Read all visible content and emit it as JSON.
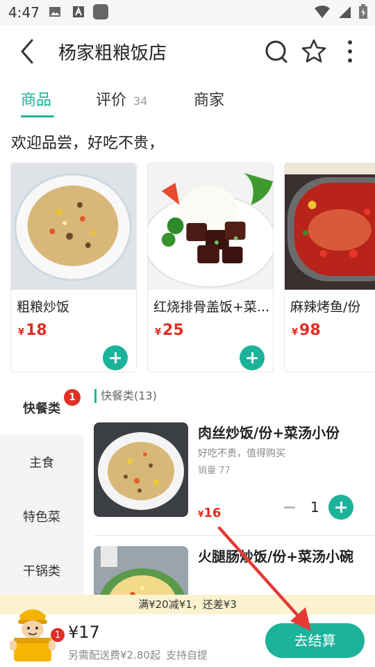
{
  "status_bar": {
    "time": "4:47"
  },
  "header": {
    "title": "杨家粗粮饭店"
  },
  "tabs": [
    {
      "label": "商品"
    },
    {
      "label": "评价",
      "count": "34"
    },
    {
      "label": "商家"
    }
  ],
  "welcome": "欢迎品尝，好吃不贵，",
  "featured": [
    {
      "name": "粗粮炒饭",
      "currency": "¥",
      "price": "18"
    },
    {
      "name": "红烧排骨盖饭+菜...",
      "currency": "¥",
      "price": "25"
    },
    {
      "name": "麻辣烤鱼/份",
      "currency": "¥",
      "price": "98"
    }
  ],
  "categories": [
    {
      "label": "快餐类",
      "badge": "1"
    },
    {
      "label": "主食"
    },
    {
      "label": "特色菜"
    },
    {
      "label": "干锅类"
    }
  ],
  "section": {
    "title": "快餐类(13)"
  },
  "products": [
    {
      "name": "肉丝炒饭/份+菜汤小份",
      "desc": "好吃不贵，值得购买",
      "sales": "销量 77",
      "currency": "¥",
      "price": "16",
      "qty": "1"
    },
    {
      "name": "火腿肠炒饭/份+菜汤小碗"
    }
  ],
  "promo": "满¥20减¥1，还差¥3",
  "cart": {
    "badge": "1",
    "total": "¥17",
    "fee_note": "另需配送费¥2.80起",
    "pickup": "支持自提",
    "checkout_label": "去结算"
  },
  "colors": {
    "accent": "#1bb39a",
    "price": "#e02e24",
    "promo_bg": "#fcf2cf",
    "annotation": "#e53935"
  }
}
